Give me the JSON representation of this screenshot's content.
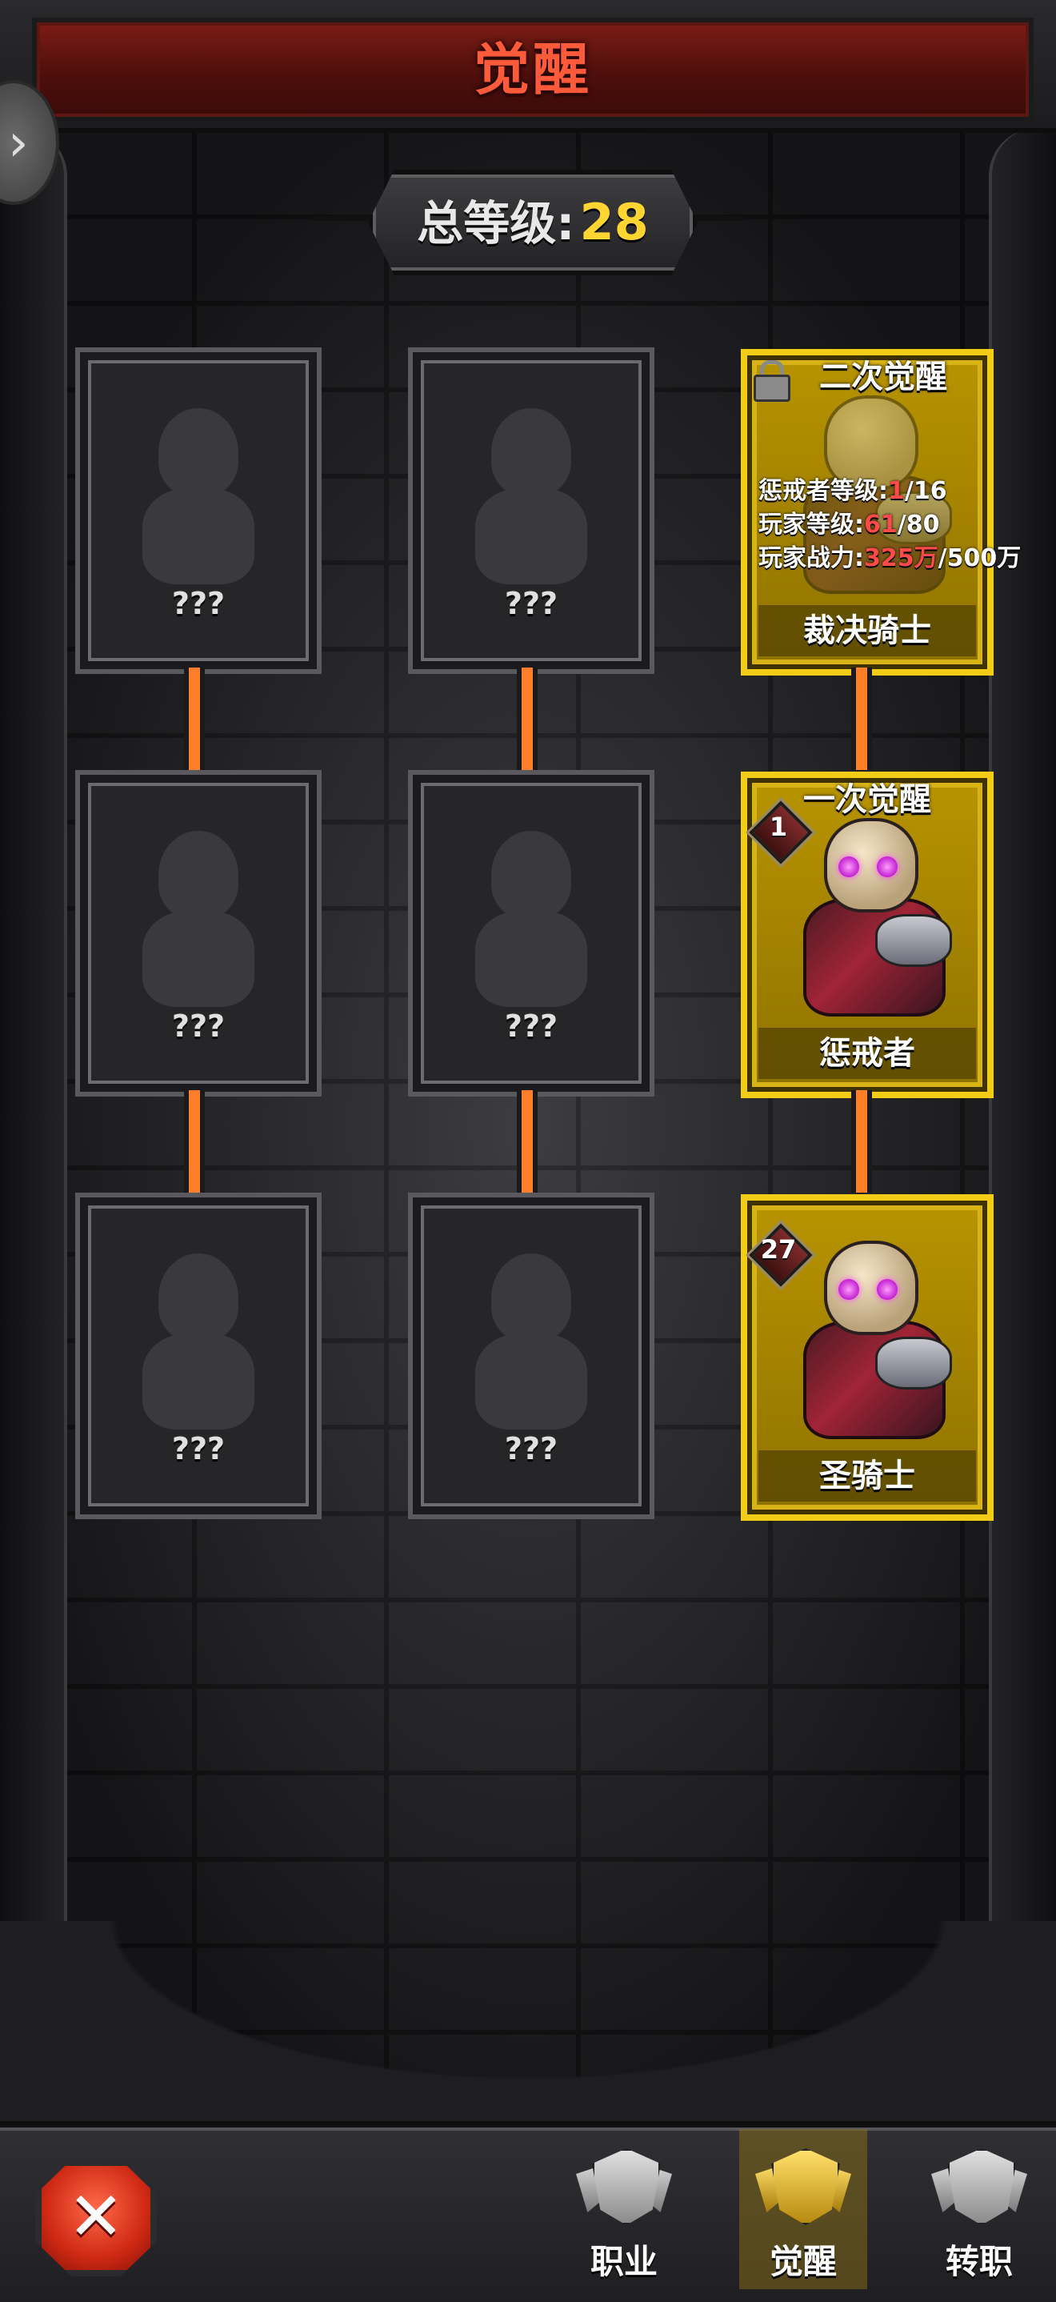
{
  "header": {
    "title": "觉醒"
  },
  "total_level": {
    "label": "总等级:",
    "value": "28"
  },
  "locked_cards": [
    {
      "text": "???"
    },
    {
      "text": "???"
    },
    {
      "text": "???"
    },
    {
      "text": "???"
    },
    {
      "text": "???"
    },
    {
      "text": "???"
    }
  ],
  "path": {
    "second_awakening": {
      "title": "二次觉醒",
      "requirements": [
        {
          "label": "惩戒者等级:",
          "current": "1",
          "target": "/16"
        },
        {
          "label": "玩家等级:",
          "current": "61",
          "target": "/80"
        },
        {
          "label": "玩家战力:",
          "current": "325万",
          "target": "/500万"
        }
      ],
      "name": "裁决骑士"
    },
    "first_awakening": {
      "title": "一次觉醒",
      "badge": "1",
      "name": "惩戒者"
    },
    "base": {
      "badge": "27",
      "name": "圣骑士"
    }
  },
  "nav": {
    "close_icon": "close-x-icon",
    "tabs": [
      {
        "label": "职业",
        "icon": "class-emblem-icon",
        "active": false
      },
      {
        "label": "觉醒",
        "icon": "awaken-emblem-icon",
        "active": true
      },
      {
        "label": "转职",
        "icon": "transfer-emblem-icon",
        "active": false
      }
    ]
  },
  "colors": {
    "gold": "#f3cc18",
    "title_red": "#ff5a3a",
    "level_yellow": "#ffd531",
    "connector": "#ff7e2a",
    "req_red": "#ff4a4a"
  }
}
